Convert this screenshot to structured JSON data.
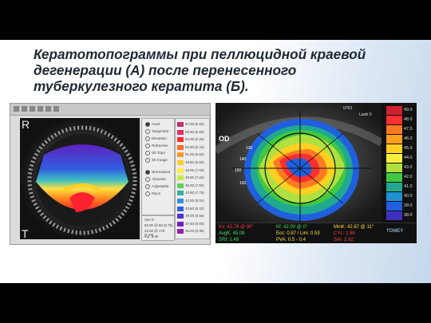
{
  "slide": {
    "title_lines": [
      "Кератотопограммы при пеллюцидной краевой",
      "дегенерации (А) после перенесенного",
      "туберкулезного кератита (Б)."
    ]
  },
  "panel_a": {
    "letters": {
      "top_left": "R",
      "bottom_left": "T",
      "bottom_right": "N"
    },
    "menu_items": [
      {
        "label": "Axial",
        "on": true
      },
      {
        "label": "Tangential",
        "on": false
      },
      {
        "label": "Elevation",
        "on": false
      },
      {
        "label": "Refractive",
        "on": false
      },
      {
        "label": "3D Topo",
        "on": false
      },
      {
        "label": "3D Image",
        "on": false
      },
      {
        "label": "Normalized",
        "on": true
      },
      {
        "label": "Absolute",
        "on": false
      },
      {
        "label": "Adjustable",
        "on": false
      },
      {
        "label": "Klyce",
        "on": false
      }
    ],
    "legend": [
      {
        "value": "57.00 (5.92)",
        "color": "#c0306a"
      },
      {
        "value": "55.50 (6.08)",
        "color": "#e0306a"
      },
      {
        "value": "54.00 (6.25)",
        "color": "#ff2a2a"
      },
      {
        "value": "52.50 (6.43)",
        "color": "#ff6a2a"
      },
      {
        "value": "51.00 (6.62)",
        "color": "#ff9a2a"
      },
      {
        "value": "49.50 (6.82)",
        "color": "#ffcc2a"
      },
      {
        "value": "48.00 (7.03)",
        "color": "#ffee40"
      },
      {
        "value": "46.50 (7.26)",
        "color": "#c8ee40"
      },
      {
        "value": "45.00 (7.50)",
        "color": "#60d060"
      },
      {
        "value": "43.50 (7.76)",
        "color": "#30b0a0"
      },
      {
        "value": "42.00 (8.04)",
        "color": "#3090e0"
      },
      {
        "value": "40.50 (8.33)",
        "color": "#3060e0"
      },
      {
        "value": "39.00 (8.65)",
        "color": "#5030d0"
      },
      {
        "value": "37.50 (9.00)",
        "color": "#7020c0"
      },
      {
        "value": "36.00 (9.38)",
        "color": "#9020b0"
      }
    ],
    "info": [
      "Sim K:",
      "50.00 @ 88 (6.75)",
      "43.50 @ 178 (7.76)",
      "Cyl: 6.50"
    ],
    "colors": {
      "warm": "#ff3030",
      "cool": "#5030d0"
    }
  },
  "panel_b": {
    "eye_label": "OD",
    "top_right": [
      "0763",
      "Lasik 5"
    ],
    "ring_labels": [
      "130",
      "140",
      "150",
      "160"
    ],
    "scale": [
      {
        "value": "49.0",
        "color": "#d02030"
      },
      {
        "value": "48.0",
        "color": "#ff3030"
      },
      {
        "value": "47.0",
        "color": "#ff7a20"
      },
      {
        "value": "46.0",
        "color": "#ffa020"
      },
      {
        "value": "45.0",
        "color": "#ffd020"
      },
      {
        "value": "44.0",
        "color": "#f5f040"
      },
      {
        "value": "43.0",
        "color": "#b0e040"
      },
      {
        "value": "42.0",
        "color": "#40c840"
      },
      {
        "value": "41.0",
        "color": "#20a890"
      },
      {
        "value": "40.0",
        "color": "#2090d0"
      },
      {
        "value": "39.0",
        "color": "#2060e0"
      },
      {
        "value": "38.0",
        "color": "#4030c0"
      }
    ],
    "bottom_stats": [
      {
        "text": "Ks: 42.78 @ 90°",
        "color": "#ff4040"
      },
      {
        "text": "Kf: 42.00 @ 0°",
        "color": "#40e060"
      },
      {
        "text": "MinK: 42.67 @ 11°",
        "color": "#ffe040"
      },
      {
        "text": "AvgK: 45.08",
        "color": "#40e060"
      },
      {
        "text": "Ecc: 0.87 / Lim: 0.53",
        "color": "#ffe040"
      },
      {
        "text": "CYL: 1.98",
        "color": "#ff4040"
      },
      {
        "text": "SRI: 1.49",
        "color": "#40e060"
      },
      {
        "text": "PVA: 0.5 - 0.4",
        "color": "#ffe040"
      },
      {
        "text": "SAI: 2.92",
        "color": "#ff4040"
      }
    ],
    "logo": "TOMEY"
  }
}
